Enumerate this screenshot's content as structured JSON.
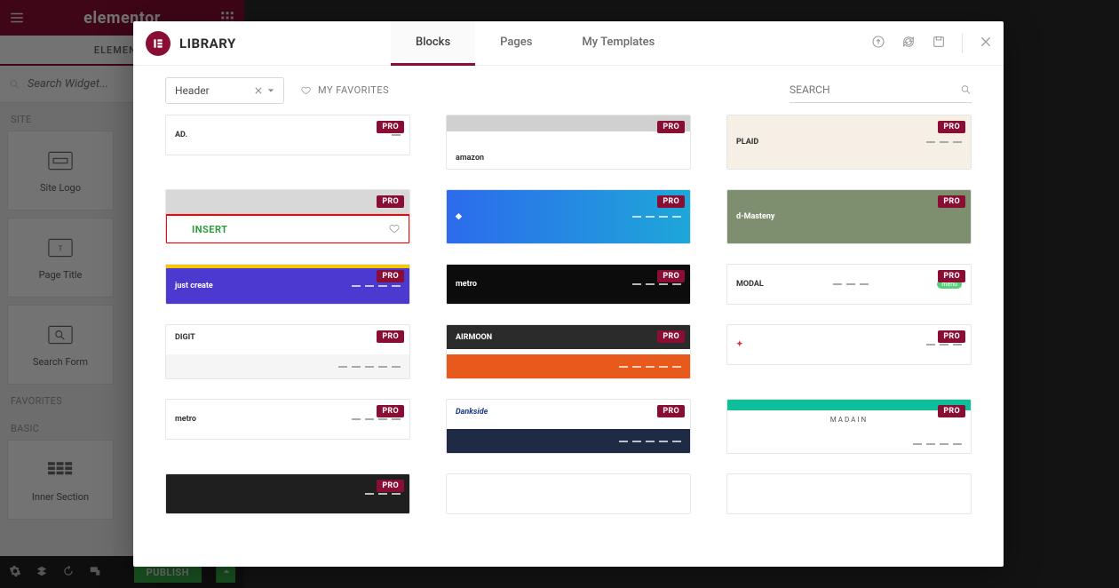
{
  "brand": "elementor",
  "editor": {
    "tab": "ELEMENTS",
    "search_placeholder": "Search Widget...",
    "sections": {
      "site": "SITE",
      "favorites": "FAVORITES",
      "basic": "BASIC"
    },
    "widgets": {
      "site_logo": "Site Logo",
      "page_title": "Page Title",
      "search_form": "Search Form",
      "inner_section": "Inner Section"
    },
    "publish": "PUBLISH"
  },
  "library": {
    "title": "LIBRARY",
    "tabs": {
      "blocks": "Blocks",
      "pages": "Pages",
      "my_templates": "My Templates"
    },
    "filter_value": "Header",
    "favorites_label": "MY FAVORITES",
    "search_placeholder": "SEARCH",
    "pro_badge": "PRO",
    "insert_label": "INSERT",
    "thumbs": {
      "ad": "AD.",
      "amazon": "amazon",
      "plaid": "PLAID",
      "metro": "metro",
      "modal": "MODAL",
      "digit": "DIGIT",
      "airmoon": "AIRMOON",
      "dankside": "Dankside",
      "madain": "MADAIN",
      "justcreate": "just create",
      "dmasteny": "d-Masteny"
    }
  }
}
